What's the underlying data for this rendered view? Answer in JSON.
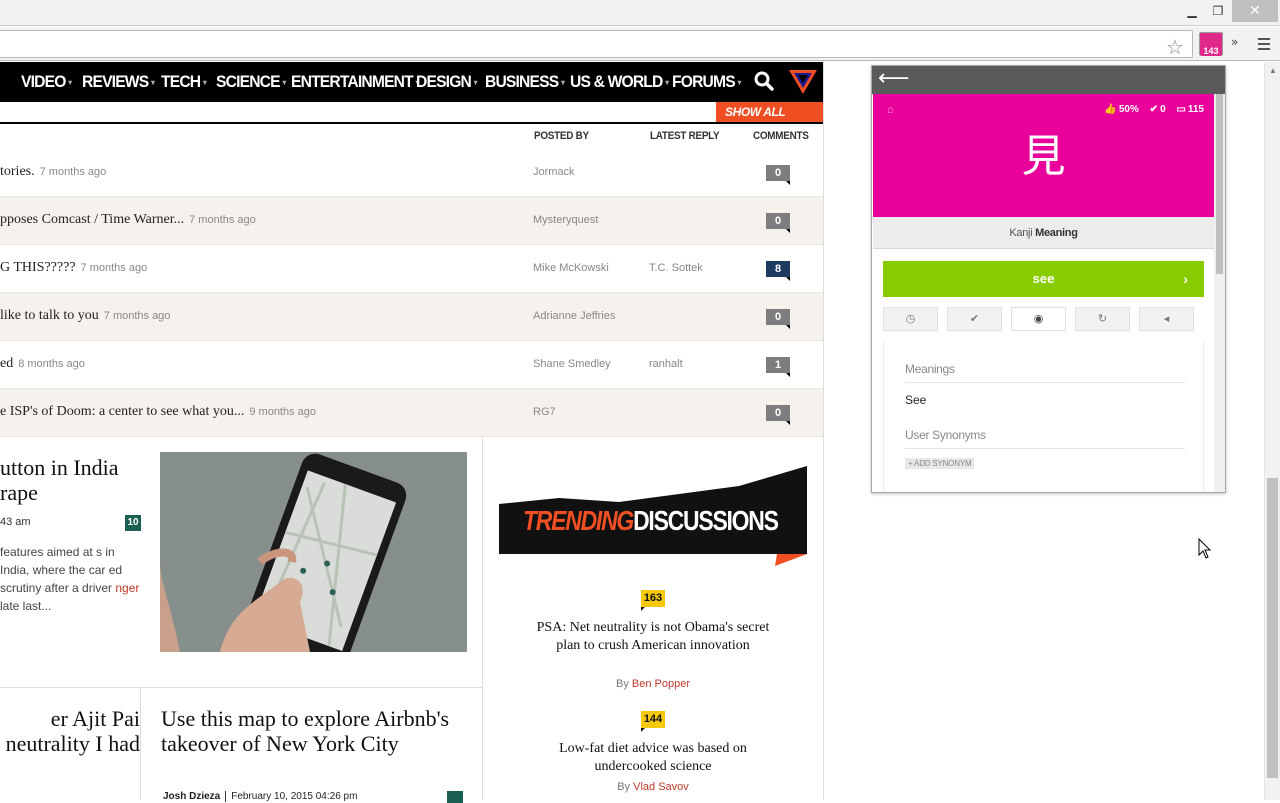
{
  "browser": {
    "extension_badge": "143",
    "window_controls": {
      "minimize": "▁",
      "restore": "❐",
      "close": "✕"
    },
    "overflow": "»"
  },
  "nav": {
    "items": [
      "VIDEO",
      "REVIEWS",
      "TECH",
      "SCIENCE",
      "ENTERTAINMENT",
      "DESIGN",
      "BUSINESS",
      "US & WORLD",
      "FORUMS"
    ],
    "dropdown_glyph": "▾"
  },
  "forums": {
    "show_all_label": "SHOW ALL FORUMS",
    "columns": {
      "posted_by": "POSTED BY",
      "latest_reply": "LATEST REPLY",
      "comments": "COMMENTS"
    },
    "rows": [
      {
        "title": "tories.",
        "ago": "7 months ago",
        "poster": "Jormack",
        "latest": "",
        "comments": "0"
      },
      {
        "title": "pposes Comcast / Time Warner...",
        "ago": "7 months ago",
        "poster": "Mysteryquest",
        "latest": "",
        "comments": "0"
      },
      {
        "title": "G THIS?????",
        "ago": "7 months ago",
        "poster": "Mike McKowski",
        "latest": "T.C. Sottek",
        "comments": "8"
      },
      {
        "title": "like to talk to you",
        "ago": "7 months ago",
        "poster": "Adrianne Jeffries",
        "latest": "",
        "comments": "0"
      },
      {
        "title": "ed",
        "ago": "8 months ago",
        "poster": "Shane Smedley",
        "latest": "ranhalt",
        "comments": "1"
      },
      {
        "title": "e ISP's of Doom: a center to see what you...",
        "ago": "9 months ago",
        "poster": "RG7",
        "latest": "",
        "comments": "0"
      }
    ]
  },
  "stories": {
    "s1": {
      "title": "utton in India rape",
      "meta": "43 am",
      "comments": "10",
      "excerpt_1": "features aimed at s in India, where the car ed scrutiny after a driver ",
      "excerpt_red": "nger",
      "excerpt_2": " late last..."
    },
    "s2": {
      "title": "er Ajit Pai neutrality I had"
    },
    "s3": {
      "title": "Use this map to explore Airbnb's takeover of New York City",
      "author": "Josh Dzieza",
      "date": "February 10, 2015 04:26 pm"
    }
  },
  "trending": {
    "label_a": "TRENDING",
    "label_b": "DISCUSSIONS",
    "items": [
      {
        "count": "163",
        "title": "PSA: Net neutrality is not Obama's secret plan to crush American innovation",
        "by": "By",
        "author": "Ben Popper"
      },
      {
        "count": "144",
        "title": "Low-fat diet advice was based on undercooked science",
        "by": "By",
        "author": "Vlad Savov"
      }
    ]
  },
  "popup": {
    "back_glyph": "⟵",
    "home_glyph": "⌂",
    "stats": {
      "percent": "50%",
      "correct": "0",
      "reviews": "115"
    },
    "kanji": "見",
    "subtitle_a": "Kanji",
    "subtitle_b": "Meaning",
    "answer": "see",
    "answer_go": "›",
    "tools": [
      "◷",
      "✔",
      "◉",
      "↻",
      "◂"
    ],
    "meanings_heading": "Meanings",
    "meaning_value": "See",
    "synonyms_heading": "User Synonyms",
    "add_synonym": "+ ADD SYNONYM"
  },
  "colors": {
    "kanji_card": "#e8019a",
    "answer_bar": "#88cc00",
    "show_all": "#f04e23",
    "trend_count": "#f6c90e"
  }
}
